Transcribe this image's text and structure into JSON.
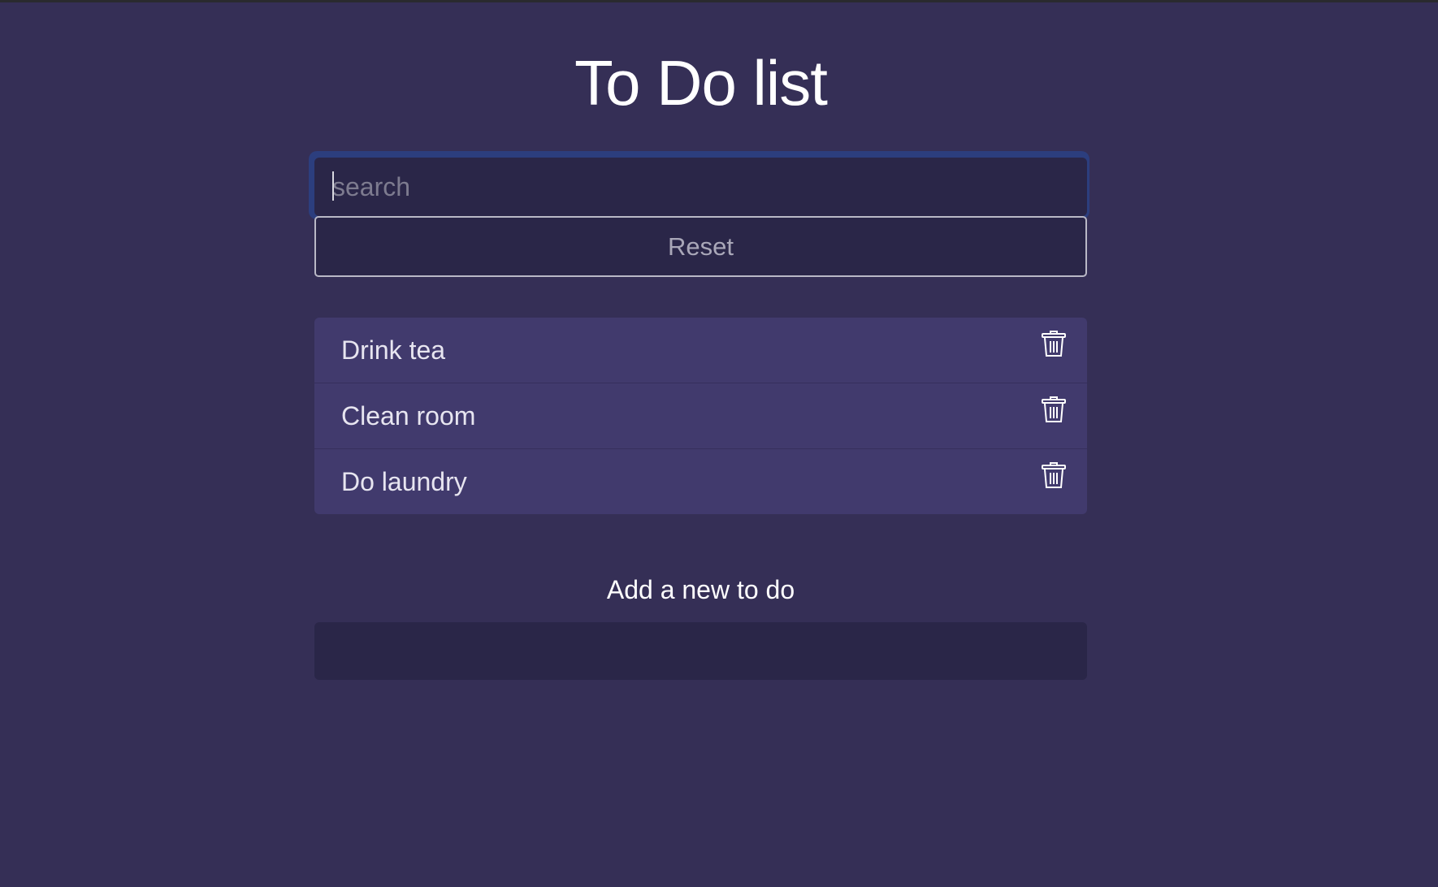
{
  "page": {
    "title": "To Do list"
  },
  "search": {
    "placeholder": "search",
    "value": ""
  },
  "reset_button": {
    "label": "Reset"
  },
  "todos": [
    {
      "text": "Drink tea",
      "delete_icon": "trash-icon"
    },
    {
      "text": "Clean room",
      "delete_icon": "trash-icon"
    },
    {
      "text": "Do laundry",
      "delete_icon": "trash-icon"
    }
  ],
  "add_form": {
    "label": "Add a new to do",
    "value": ""
  },
  "colors": {
    "background": "#352f56",
    "input_background": "#2a2648",
    "list_item_background": "#413a6d",
    "focus_ring": "#2c3e7e",
    "text": "#ffffff"
  }
}
